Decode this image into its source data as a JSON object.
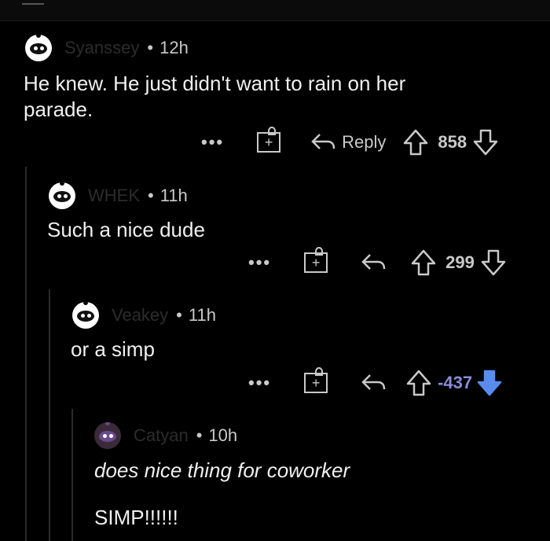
{
  "comments": [
    {
      "username": "Syanssey",
      "age": "12h",
      "lines": [
        "He knew. He just didn't want to rain on her",
        "parade."
      ],
      "reply_label": "Reply",
      "votes": "858",
      "more": "•••",
      "gift_plus": "+"
    },
    {
      "username": "WHEK",
      "age": "11h",
      "lines": [
        "Such a nice dude"
      ],
      "votes": "299",
      "more": "•••",
      "gift_plus": "+"
    },
    {
      "username": "Veakey",
      "age": "11h",
      "lines": [
        "or a simp"
      ],
      "votes": "-437",
      "more": "•••",
      "gift_plus": "+"
    },
    {
      "username": "Catyan",
      "age": "10h",
      "lines": [
        "does nice thing for coworker",
        "SIMP!!!!!!"
      ]
    }
  ],
  "colors": {
    "background": "#000000",
    "text": "#f0f0f0",
    "meta": "#c9c9c9",
    "negative_votes": "#8b8bdb",
    "downvote_active": "#5a8cf0"
  }
}
